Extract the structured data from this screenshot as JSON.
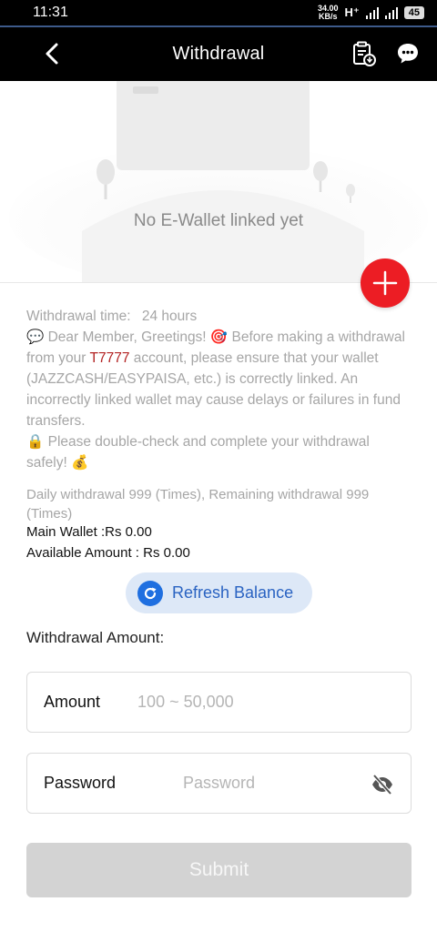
{
  "status_bar": {
    "time": "11:31",
    "net_speed_value": "34.00",
    "net_speed_unit": "KB/s",
    "network_type": "H⁺",
    "battery": "45"
  },
  "header": {
    "title": "Withdrawal",
    "back_icon": "chevron-left-icon",
    "records_icon": "clipboard-download-icon",
    "support_icon": "chat-support-icon"
  },
  "wallet": {
    "empty_text": "No E-Wallet linked yet",
    "add_icon": "plus-icon",
    "add_color": "#ec1d24"
  },
  "info": {
    "withdrawal_time_label": "Withdrawal time:",
    "withdrawal_time_value": "24 hours",
    "msg_part1": "💬 Dear Member, Greetings! 🎯 Before making a withdrawal from your ",
    "brand": "T7777",
    "msg_part2": " account, please ensure that your wallet (JAZZCASH/EASYPAISA, etc.) is correctly linked. An incorrectly linked wallet may cause delays or failures in fund transfers.",
    "msg_part3": "🔒 Please double-check and complete your withdrawal safely! 💰"
  },
  "limits": {
    "daily_text": "Daily withdrawal 999 (Times), Remaining withdrawal 999 (Times)",
    "main_wallet": "Main Wallet :Rs 0.00",
    "available_amount": "Available Amount : Rs 0.00"
  },
  "refresh": {
    "label": "Refresh Balance",
    "icon": "refresh-icon"
  },
  "form": {
    "amount_title": "Withdrawal Amount:",
    "amount_label": "Amount",
    "amount_placeholder": "100 ~ 50,000",
    "password_label": "Password",
    "password_placeholder": "Password",
    "eye_icon": "eye-off-icon",
    "submit_label": "Submit"
  }
}
